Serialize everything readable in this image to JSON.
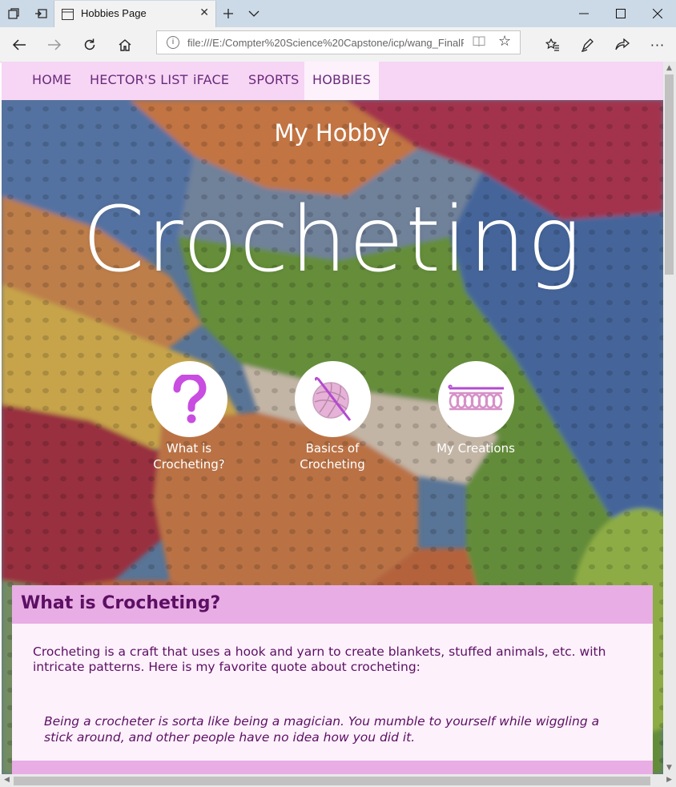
{
  "browser": {
    "tab_title": "Hobbies Page",
    "address": "file:///E:/Compter%20Science%20Capstone/icp/wang_FinalP",
    "icons": [
      "tab-list-icon",
      "set-aside-tabs-icon",
      "page-icon",
      "close-tab-icon",
      "new-tab-icon",
      "tab-dropdown-icon",
      "minimize-icon",
      "maximize-icon",
      "close-window-icon",
      "back-icon",
      "forward-icon",
      "refresh-icon",
      "home-icon",
      "info-icon",
      "reading-view-icon",
      "favorite-star-icon",
      "favorites-list-icon",
      "pen-icon",
      "share-icon",
      "more-icon"
    ]
  },
  "nav": {
    "items": [
      {
        "label": "HOME"
      },
      {
        "label": "HECTOR'S LIST"
      },
      {
        "label": "iFACE"
      },
      {
        "label": "SPORTS"
      },
      {
        "label": "HOBBIES"
      }
    ],
    "active": "HOBBIES"
  },
  "hero": {
    "subtitle": "My Hobby",
    "title": "Crocheting",
    "links": [
      {
        "label": "What is Crocheting?",
        "icon": "question-mark-icon"
      },
      {
        "label": "Basics of Crocheting",
        "icon": "yarn-ball-icon"
      },
      {
        "label": "My Creations",
        "icon": "crochet-chain-icon"
      }
    ]
  },
  "section": {
    "title": "What is Crocheting?",
    "body": "Crocheting is a craft that uses a hook and yarn to create blankets, stuffed animals, etc. with intricate patterns. Here is my favorite quote about crocheting:",
    "quote": "Being a crocheter is sorta like being a magician. You mumble to yourself while wiggling a stick around, and other people have no idea how you did it."
  },
  "colors": {
    "nav_bg": "#f6d6f4",
    "nav_text": "#6b2a7c",
    "section_header_bg": "#e8ade4",
    "section_bg": "#fdf1fc",
    "section_text": "#5c0f63",
    "icon_accent": "#c84de0"
  }
}
